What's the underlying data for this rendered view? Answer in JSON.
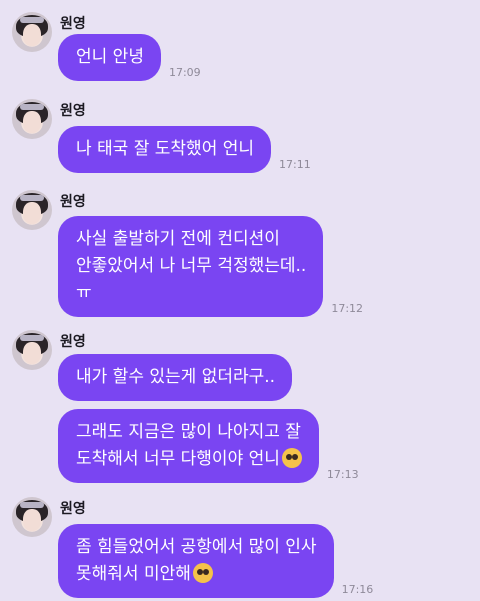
{
  "messages": [
    {
      "sender": "원영",
      "lines": [
        "언니 안녕"
      ],
      "time": "17:09"
    },
    {
      "sender": "원영",
      "lines": [
        "나 태국 잘 도착했어 언니"
      ],
      "time": "17:11"
    },
    {
      "sender": "원영",
      "lines": [
        "사실 출발하기 전에 컨디션이",
        "안좋았어서 나 너무 걱정했는데..",
        "ㅠ"
      ],
      "time": "17:12"
    },
    {
      "sender": "원영",
      "lines": [
        "내가 할수 있는게 없더라구.."
      ],
      "time": ""
    },
    {
      "sender": "",
      "lines": [
        "그래도 지금은 많이 나아지고 잘",
        "도착해서 너무 다행이야 언니"
      ],
      "time": "17:13",
      "emoji": "pleading-face-emoji"
    },
    {
      "sender": "원영",
      "lines": [
        "좀 힘들었어서 공항에서 많이 인사",
        "못해줘서 미안해"
      ],
      "time": "17:16",
      "emoji": "pleading-face-emoji"
    }
  ],
  "colors": {
    "background": "#e8e2f3",
    "bubble": "#7a45f2",
    "bubble_text": "#ffffff",
    "time": "#8f8a99"
  }
}
